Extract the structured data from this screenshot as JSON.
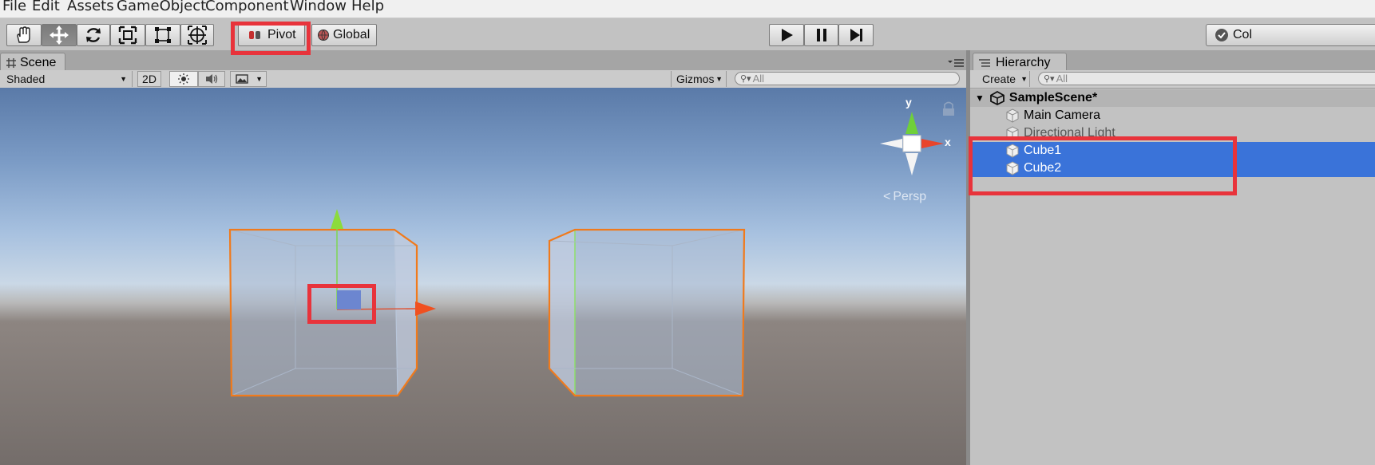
{
  "menu": [
    "File",
    "Edit",
    "Assets",
    "GameObject",
    "Component",
    "Window",
    "Help"
  ],
  "toolbar": {
    "tools": [
      "hand-icon",
      "move-icon",
      "rotate-icon",
      "scale-icon",
      "rect-icon",
      "transform-icon"
    ],
    "pivot_label": "Pivot",
    "global_label": "Global",
    "play": [
      "play-icon",
      "pause-icon",
      "step-icon"
    ],
    "collab_label": "Col"
  },
  "scene": {
    "tab_label": "Scene",
    "shading_mode": "Shaded",
    "mode_2d": "2D",
    "gizmos_label": "Gizmos",
    "search_placeholder": "All",
    "gizmo": {
      "y_label": "y",
      "x_label": "x",
      "persp_label": "Persp"
    }
  },
  "hierarchy": {
    "tab_label": "Hierarchy",
    "create_label": "Create",
    "search_placeholder": "All",
    "scene_name": "SampleScene*",
    "items": [
      "Main Camera",
      "Directional Light",
      "Cube1",
      "Cube2"
    ],
    "selected": [
      "Cube1",
      "Cube2"
    ]
  },
  "colors": {
    "selection": "#3a73d9",
    "highlight": "#e8333b",
    "selected_outline": "#f07a1c"
  }
}
